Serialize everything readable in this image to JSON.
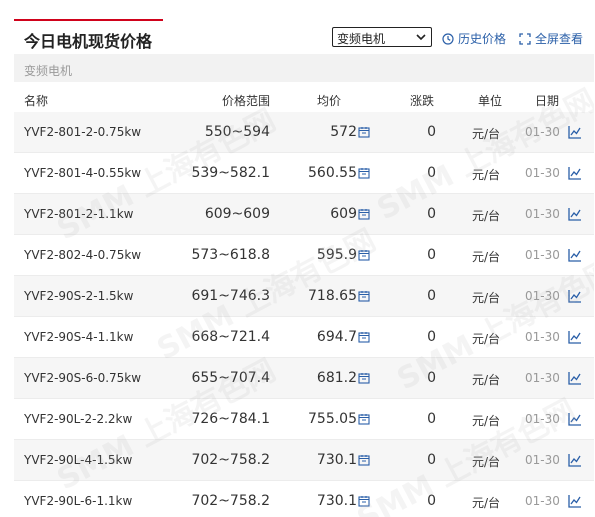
{
  "header": {
    "title": "今日电机现货价格",
    "select_value": "变频电机",
    "history_label": "历史价格",
    "fullscreen_label": "全屏查看"
  },
  "category": "变频电机",
  "columns": {
    "name": "名称",
    "range": "价格范围",
    "avg": "均价",
    "change": "涨跌",
    "unit": "单位",
    "date": "日期"
  },
  "rows": [
    {
      "name": "YVF2-801-2-0.75kw",
      "range": "550~594",
      "avg": "572",
      "change": "0",
      "unit": "元/台",
      "date": "01-30"
    },
    {
      "name": "YVF2-801-4-0.55kw",
      "range": "539~582.1",
      "avg": "560.55",
      "change": "0",
      "unit": "元/台",
      "date": "01-30"
    },
    {
      "name": "YVF2-801-2-1.1kw",
      "range": "609~609",
      "avg": "609",
      "change": "0",
      "unit": "元/台",
      "date": "01-30"
    },
    {
      "name": "YVF2-802-4-0.75kw",
      "range": "573~618.8",
      "avg": "595.9",
      "change": "0",
      "unit": "元/台",
      "date": "01-30"
    },
    {
      "name": "YVF2-90S-2-1.5kw",
      "range": "691~746.3",
      "avg": "718.65",
      "change": "0",
      "unit": "元/台",
      "date": "01-30"
    },
    {
      "name": "YVF2-90S-4-1.1kw",
      "range": "668~721.4",
      "avg": "694.7",
      "change": "0",
      "unit": "元/台",
      "date": "01-30"
    },
    {
      "name": "YVF2-90S-6-0.75kw",
      "range": "655~707.4",
      "avg": "681.2",
      "change": "0",
      "unit": "元/台",
      "date": "01-30"
    },
    {
      "name": "YVF2-90L-2-2.2kw",
      "range": "726~784.1",
      "avg": "755.05",
      "change": "0",
      "unit": "元/台",
      "date": "01-30"
    },
    {
      "name": "YVF2-90L-4-1.5kw",
      "range": "702~758.2",
      "avg": "730.1",
      "change": "0",
      "unit": "元/台",
      "date": "01-30"
    },
    {
      "name": "YVF2-90L-6-1.1kw",
      "range": "702~758.2",
      "avg": "730.1",
      "change": "0",
      "unit": "元/台",
      "date": "01-30"
    }
  ],
  "watermark": "SMM 上海有色网",
  "colors": {
    "accent": "#d0021b",
    "link": "#2a5fa8",
    "stripe": "#f6f6f6",
    "category_bar": "#f2f2f2"
  }
}
